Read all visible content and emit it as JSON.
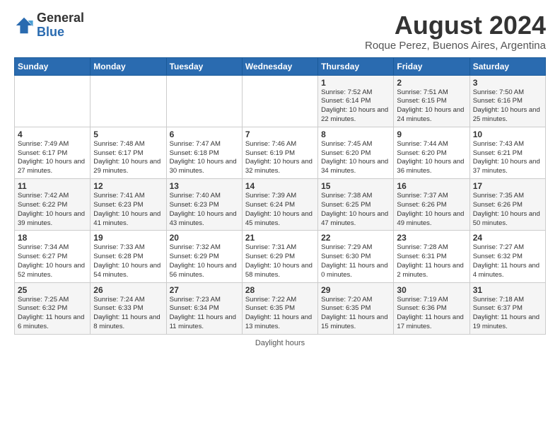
{
  "logo": {
    "general": "General",
    "blue": "Blue"
  },
  "title": "August 2024",
  "location": "Roque Perez, Buenos Aires, Argentina",
  "weekdays": [
    "Sunday",
    "Monday",
    "Tuesday",
    "Wednesday",
    "Thursday",
    "Friday",
    "Saturday"
  ],
  "footer": "Daylight hours",
  "weeks": [
    [
      {
        "day": "",
        "sunrise": "",
        "sunset": "",
        "daylight": ""
      },
      {
        "day": "",
        "sunrise": "",
        "sunset": "",
        "daylight": ""
      },
      {
        "day": "",
        "sunrise": "",
        "sunset": "",
        "daylight": ""
      },
      {
        "day": "",
        "sunrise": "",
        "sunset": "",
        "daylight": ""
      },
      {
        "day": "1",
        "sunrise": "7:52 AM",
        "sunset": "6:14 PM",
        "daylight": "10 hours and 22 minutes."
      },
      {
        "day": "2",
        "sunrise": "7:51 AM",
        "sunset": "6:15 PM",
        "daylight": "10 hours and 24 minutes."
      },
      {
        "day": "3",
        "sunrise": "7:50 AM",
        "sunset": "6:16 PM",
        "daylight": "10 hours and 25 minutes."
      }
    ],
    [
      {
        "day": "4",
        "sunrise": "7:49 AM",
        "sunset": "6:17 PM",
        "daylight": "10 hours and 27 minutes."
      },
      {
        "day": "5",
        "sunrise": "7:48 AM",
        "sunset": "6:17 PM",
        "daylight": "10 hours and 29 minutes."
      },
      {
        "day": "6",
        "sunrise": "7:47 AM",
        "sunset": "6:18 PM",
        "daylight": "10 hours and 30 minutes."
      },
      {
        "day": "7",
        "sunrise": "7:46 AM",
        "sunset": "6:19 PM",
        "daylight": "10 hours and 32 minutes."
      },
      {
        "day": "8",
        "sunrise": "7:45 AM",
        "sunset": "6:20 PM",
        "daylight": "10 hours and 34 minutes."
      },
      {
        "day": "9",
        "sunrise": "7:44 AM",
        "sunset": "6:20 PM",
        "daylight": "10 hours and 36 minutes."
      },
      {
        "day": "10",
        "sunrise": "7:43 AM",
        "sunset": "6:21 PM",
        "daylight": "10 hours and 37 minutes."
      }
    ],
    [
      {
        "day": "11",
        "sunrise": "7:42 AM",
        "sunset": "6:22 PM",
        "daylight": "10 hours and 39 minutes."
      },
      {
        "day": "12",
        "sunrise": "7:41 AM",
        "sunset": "6:23 PM",
        "daylight": "10 hours and 41 minutes."
      },
      {
        "day": "13",
        "sunrise": "7:40 AM",
        "sunset": "6:23 PM",
        "daylight": "10 hours and 43 minutes."
      },
      {
        "day": "14",
        "sunrise": "7:39 AM",
        "sunset": "6:24 PM",
        "daylight": "10 hours and 45 minutes."
      },
      {
        "day": "15",
        "sunrise": "7:38 AM",
        "sunset": "6:25 PM",
        "daylight": "10 hours and 47 minutes."
      },
      {
        "day": "16",
        "sunrise": "7:37 AM",
        "sunset": "6:26 PM",
        "daylight": "10 hours and 49 minutes."
      },
      {
        "day": "17",
        "sunrise": "7:35 AM",
        "sunset": "6:26 PM",
        "daylight": "10 hours and 50 minutes."
      }
    ],
    [
      {
        "day": "18",
        "sunrise": "7:34 AM",
        "sunset": "6:27 PM",
        "daylight": "10 hours and 52 minutes."
      },
      {
        "day": "19",
        "sunrise": "7:33 AM",
        "sunset": "6:28 PM",
        "daylight": "10 hours and 54 minutes."
      },
      {
        "day": "20",
        "sunrise": "7:32 AM",
        "sunset": "6:29 PM",
        "daylight": "10 hours and 56 minutes."
      },
      {
        "day": "21",
        "sunrise": "7:31 AM",
        "sunset": "6:29 PM",
        "daylight": "10 hours and 58 minutes."
      },
      {
        "day": "22",
        "sunrise": "7:29 AM",
        "sunset": "6:30 PM",
        "daylight": "11 hours and 0 minutes."
      },
      {
        "day": "23",
        "sunrise": "7:28 AM",
        "sunset": "6:31 PM",
        "daylight": "11 hours and 2 minutes."
      },
      {
        "day": "24",
        "sunrise": "7:27 AM",
        "sunset": "6:32 PM",
        "daylight": "11 hours and 4 minutes."
      }
    ],
    [
      {
        "day": "25",
        "sunrise": "7:25 AM",
        "sunset": "6:32 PM",
        "daylight": "11 hours and 6 minutes."
      },
      {
        "day": "26",
        "sunrise": "7:24 AM",
        "sunset": "6:33 PM",
        "daylight": "11 hours and 8 minutes."
      },
      {
        "day": "27",
        "sunrise": "7:23 AM",
        "sunset": "6:34 PM",
        "daylight": "11 hours and 11 minutes."
      },
      {
        "day": "28",
        "sunrise": "7:22 AM",
        "sunset": "6:35 PM",
        "daylight": "11 hours and 13 minutes."
      },
      {
        "day": "29",
        "sunrise": "7:20 AM",
        "sunset": "6:35 PM",
        "daylight": "11 hours and 15 minutes."
      },
      {
        "day": "30",
        "sunrise": "7:19 AM",
        "sunset": "6:36 PM",
        "daylight": "11 hours and 17 minutes."
      },
      {
        "day": "31",
        "sunrise": "7:18 AM",
        "sunset": "6:37 PM",
        "daylight": "11 hours and 19 minutes."
      }
    ]
  ]
}
